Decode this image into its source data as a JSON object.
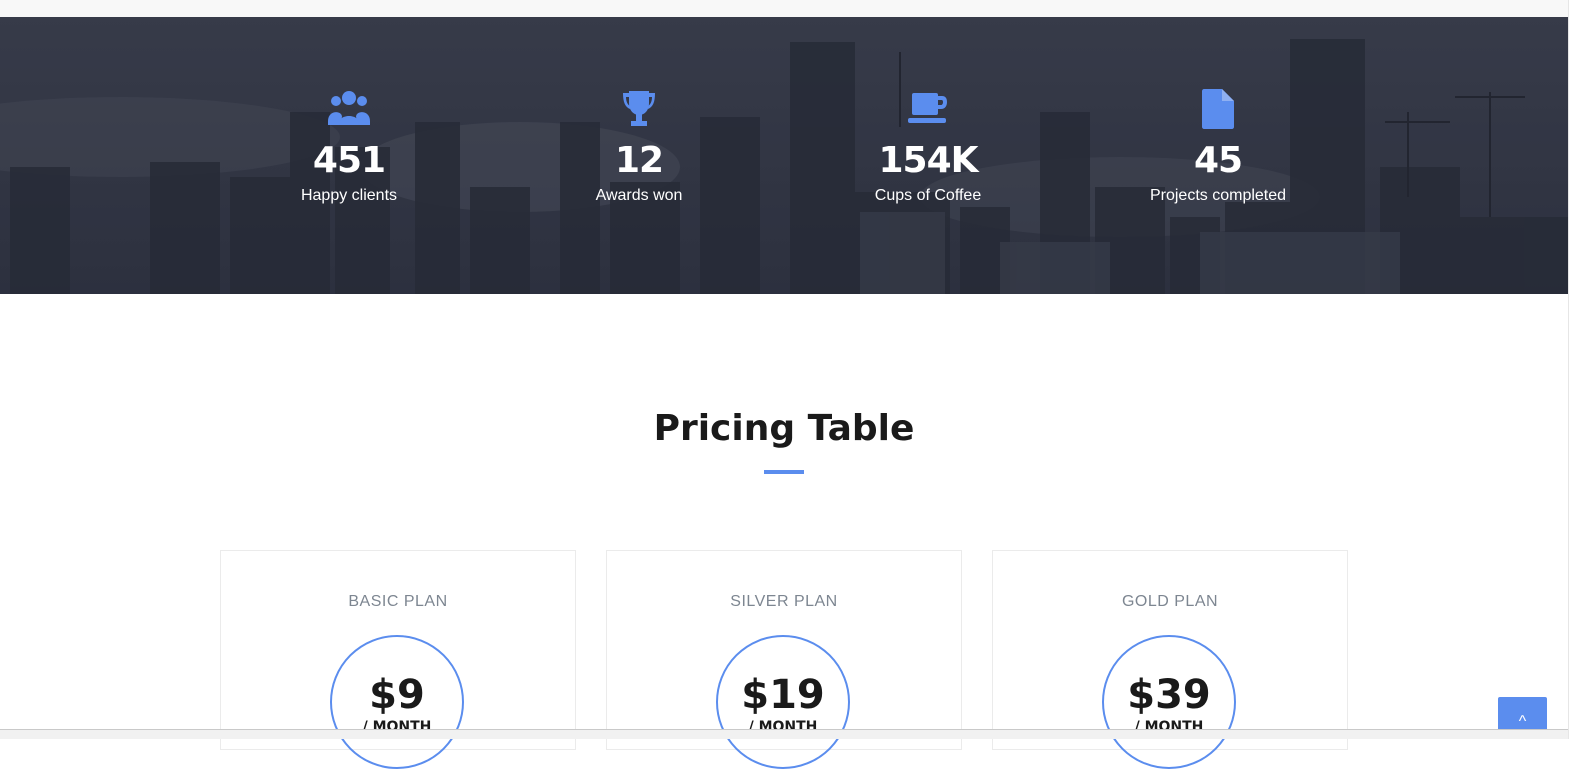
{
  "stats": [
    {
      "icon": "users-icon",
      "number": "451",
      "label": "Happy clients"
    },
    {
      "icon": "trophy-icon",
      "number": "12",
      "label": "Awards won"
    },
    {
      "icon": "coffee-cup-icon",
      "number": "154K",
      "label": "Cups of Coffee"
    },
    {
      "icon": "file-icon",
      "number": "45",
      "label": "Projects completed"
    }
  ],
  "pricing": {
    "title": "Pricing Table",
    "plans": [
      {
        "name": "BASIC PLAN",
        "price": "$9",
        "period": "/ MONTH"
      },
      {
        "name": "SILVER PLAN",
        "price": "$19",
        "period": "/ MONTH"
      },
      {
        "name": "GOLD PLAN",
        "price": "$39",
        "period": "/ MONTH"
      }
    ]
  },
  "back_to_top": {
    "icon": "chevron-up-icon",
    "glyph": "^"
  },
  "colors": {
    "accent": "#5b8dee",
    "band_background": "#343847",
    "title_text": "#1a1a1a",
    "plan_name_text": "#7d8691"
  }
}
